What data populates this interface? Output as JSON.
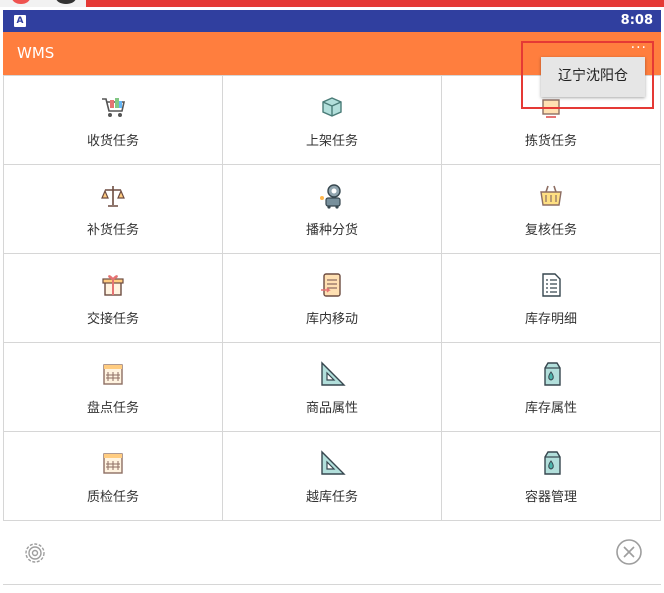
{
  "status_bar": {
    "time": "8:08",
    "notification_icon": "A"
  },
  "app_bar": {
    "title": "WMS",
    "overflow_icon": "···"
  },
  "menu": {
    "items": [
      {
        "label": "收货任务",
        "icon": "cart-icon"
      },
      {
        "label": "上架任务",
        "icon": "box-icon"
      },
      {
        "label": "拣货任务",
        "icon": "pick-icon"
      },
      {
        "label": "补货任务",
        "icon": "scale-icon"
      },
      {
        "label": "播种分货",
        "icon": "robot-icon"
      },
      {
        "label": "复核任务",
        "icon": "basket-icon"
      },
      {
        "label": "交接任务",
        "icon": "gift-icon"
      },
      {
        "label": "库内移动",
        "icon": "move-doc-icon"
      },
      {
        "label": "库存明细",
        "icon": "list-doc-icon"
      },
      {
        "label": "盘点任务",
        "icon": "calendar-icon"
      },
      {
        "label": "商品属性",
        "icon": "triangle-ruler-icon"
      },
      {
        "label": "库存属性",
        "icon": "milk-carton-icon"
      },
      {
        "label": "质检任务",
        "icon": "calendar-icon"
      },
      {
        "label": "越库任务",
        "icon": "triangle-ruler-icon"
      },
      {
        "label": "容器管理",
        "icon": "milk-carton-icon"
      }
    ]
  },
  "dropdown": {
    "option": "辽宁沈阳仓"
  },
  "bottom_bar": {
    "settings_icon": "gear-icon",
    "close_icon": "close-circle-icon"
  },
  "colors": {
    "status_bar": "#303f9f",
    "app_bar": "#ff7e3e",
    "highlight": "#e53935"
  }
}
